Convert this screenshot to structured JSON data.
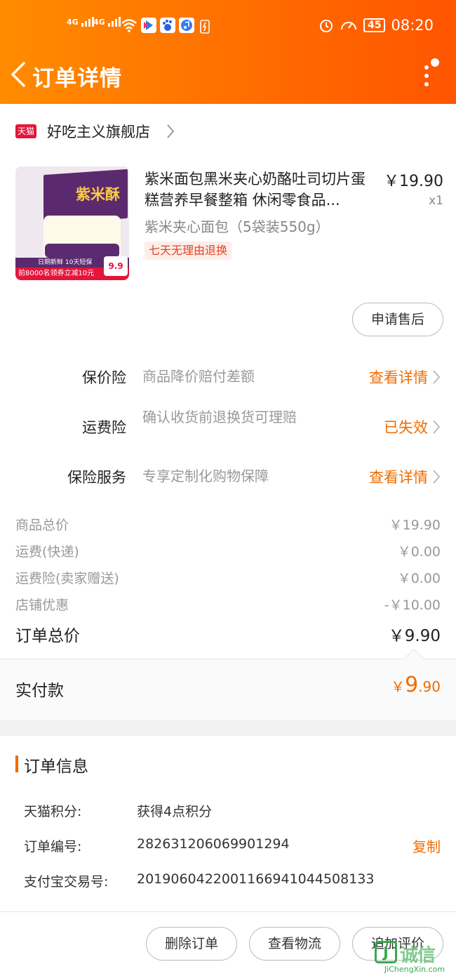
{
  "status_bar": {
    "sig1": "4G",
    "sig2": "4G",
    "battery": "45",
    "time": "08:20"
  },
  "nav": {
    "title": "订单详情"
  },
  "store": {
    "badge": "天猫",
    "name": "好吃主义旗舰店"
  },
  "product": {
    "title": "紫米面包黑米夹心奶酪吐司切片蛋糕营养早餐整箱 休闲零食品...",
    "price": "￥19.90",
    "qty": "x1",
    "sku": "紫米夹心面包（5袋装550g）",
    "tag": "七天无理由退换",
    "image": {
      "box_label": "紫米酥",
      "strip_text": "日期新鲜 10天短保",
      "coupon_text": "前8000名领券立减10元",
      "price_label": "9.9"
    }
  },
  "after_sale_button": "申请售后",
  "insurance": [
    {
      "label": "保价险",
      "desc": "商品降价赔付差额",
      "link": "查看详情"
    },
    {
      "label": "运费险",
      "desc": "确认收货前退换货可理赔",
      "link": "已失效"
    },
    {
      "label": "保险服务",
      "desc": "专享定制化购物保障",
      "link": "查看详情"
    }
  ],
  "fees": [
    {
      "label": "商品总价",
      "value": "￥19.90"
    },
    {
      "label": "运费(快递)",
      "value": "￥0.00"
    },
    {
      "label": "运费险(卖家赠送)",
      "value": "￥0.00"
    },
    {
      "label": "店铺优惠",
      "value": "-￥10.00"
    }
  ],
  "order_total": {
    "label": "订单总价",
    "value": "￥9.90"
  },
  "payment": {
    "label": "实付款",
    "currency": "￥",
    "integer": "9",
    "decimal": ".90"
  },
  "order_info": {
    "title": "订单信息",
    "rows": [
      {
        "label": "天猫积分:",
        "value": "获得4点积分"
      },
      {
        "label": "订单编号:",
        "value": "282631206069901294"
      },
      {
        "label": "支付宝交易号:",
        "value": "2019060422001166941044508133"
      }
    ],
    "copy_label": "复制"
  },
  "actions": {
    "delete": "删除订单",
    "logistics": "查看物流",
    "review": "追加评价"
  },
  "watermark": {
    "logo": "J",
    "text": "诚信",
    "sub": "JiChengXin.com"
  },
  "colors": {
    "accent": "#ff6a00",
    "link": "#ef6c00",
    "tmall_red": "#e4153b"
  }
}
